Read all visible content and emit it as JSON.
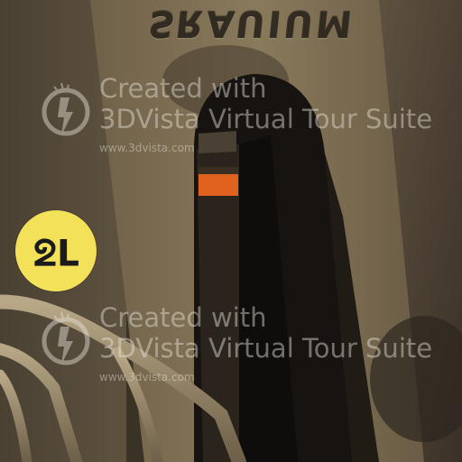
{
  "scene": {
    "engraved_label": "MUIUAЯƧ",
    "hotspot": {
      "label": "ᒣᘔ",
      "color": "#f3e15a"
    }
  },
  "watermarks": [
    {
      "line1": "Created with",
      "line2": "3DVista Virtual Tour Suite",
      "url": "www.3dvista.com"
    },
    {
      "line1": "Created with",
      "line2": "3DVista Virtual Tour Suite",
      "url": "www.3dvista.com"
    }
  ],
  "colors": {
    "background": "#3b3226",
    "wall": "#7a6a4f",
    "door_dark": "#161310",
    "light_strip": "#e0621e",
    "hotspot": "#f3e15a"
  },
  "icons": {
    "watermark_logo": "3dvista-logo-icon"
  }
}
